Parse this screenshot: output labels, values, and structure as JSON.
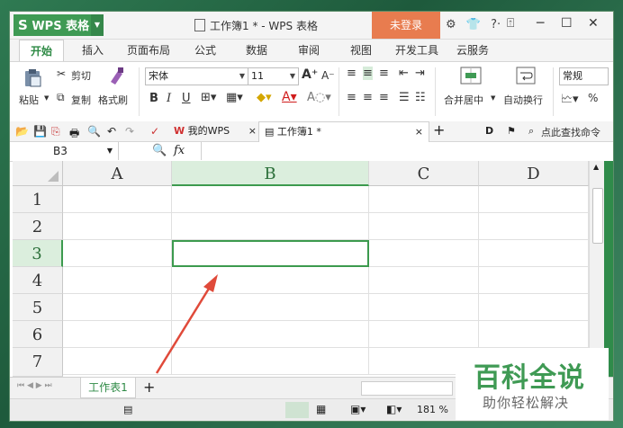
{
  "titlebar": {
    "app_button": "WPS 表格",
    "doc_title": "工作簿1 * - WPS 表格",
    "login_button": "未登录",
    "icons": [
      "settings-icon",
      "shirt-icon",
      "help-icon"
    ]
  },
  "menu": {
    "items": [
      "开始",
      "插入",
      "页面布局",
      "公式",
      "数据",
      "审阅",
      "视图",
      "开发工具",
      "云服务"
    ]
  },
  "ribbon": {
    "paste": "粘贴",
    "cut": "剪切",
    "copy": "复制",
    "format_painter": "格式刷",
    "font_name": "宋体",
    "font_size": "11",
    "merge_center": "合并居中",
    "wrap_text": "自动换行",
    "number_format": "常规",
    "percent": "%"
  },
  "quickbar": {
    "tab_home": "我的WPS",
    "tab_doc": "工作簿1 *",
    "search": "点此查找命令"
  },
  "formula_bar": {
    "cell_ref": "B3",
    "fx": "fx",
    "value": ""
  },
  "sheet": {
    "columns": [
      "A",
      "B",
      "C",
      "D"
    ],
    "rows": [
      "1",
      "2",
      "3",
      "4",
      "5",
      "6",
      "7"
    ],
    "selected_col": "B",
    "selected_row": "3"
  },
  "sheettabs": {
    "tabs": [
      "工作表1"
    ],
    "add": "+"
  },
  "statusbar": {
    "zoom": "181 %"
  },
  "watermark": {
    "title": "百科全说",
    "subtitle": "助你轻松解决"
  },
  "colors": {
    "accent": "#3f9a54",
    "login": "#e87c4f",
    "arrow": "#e04a3a"
  }
}
